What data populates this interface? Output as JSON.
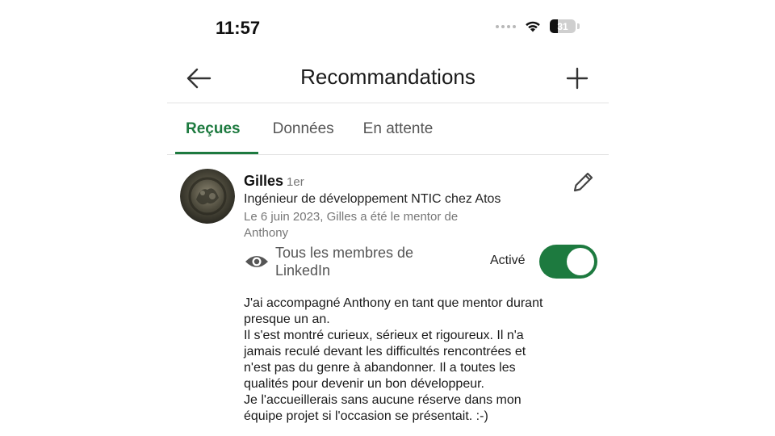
{
  "status_bar": {
    "time": "11:57",
    "battery": "31",
    "battery_level": 0.31
  },
  "header": {
    "title": "Recommandations",
    "back_icon": "arrow-left-icon",
    "add_icon": "plus-icon"
  },
  "tabs": [
    {
      "label": "Reçues",
      "active": true
    },
    {
      "label": "Données",
      "active": false
    },
    {
      "label": "En attente",
      "active": false
    }
  ],
  "recommendation": {
    "name": "Gilles",
    "degree": "1er",
    "headline": "Ingénieur de développement NTIC chez Atos",
    "meta": "Le 6 juin 2023, Gilles a été le mentor de Anthony",
    "visibility": "Tous les membres de LinkedIn",
    "toggle_label": "Activé",
    "toggle_on": true,
    "body_lines": [
      "J'ai accompagné Anthony en tant que mentor durant",
      "presque un an.",
      "Il s'est montré curieux, sérieux et rigoureux. Il n'a",
      "jamais reculé devant les difficultés rencontrées et",
      "n'est pas du genre à abandonner. Il a toutes les",
      "qualités pour devenir un bon développeur.",
      "Je l'accueillerais sans aucune réserve dans mon",
      "équipe projet si l'occasion se présentait. :-)"
    ]
  },
  "colors": {
    "accent": "#1d7a3f",
    "muted": "#777777",
    "text": "#1a1a1a"
  }
}
